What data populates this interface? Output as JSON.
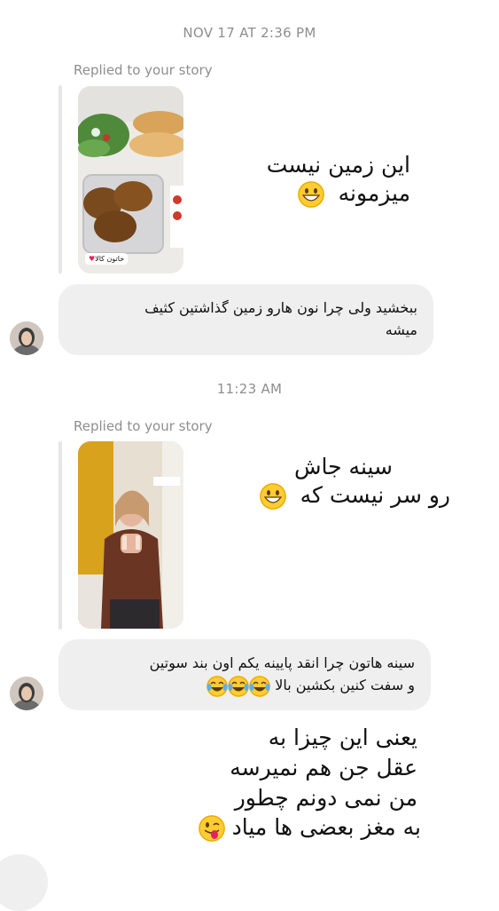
{
  "conversation": {
    "timestamp_1": "NOV 17 AT 2:36 PM",
    "timestamp_2": "11:23 AM",
    "reply_1": {
      "label": "Replied to your story",
      "story_tag": "خاتون کالا",
      "line1": "این زمین نیست",
      "line2": "میزمونه",
      "emoji": "grinning-face"
    },
    "incoming_1": {
      "line1": "ببخشید ولی چرا نون هارو زمین گذاشتین کثیف",
      "line2": "میشه"
    },
    "reply_2": {
      "label": "Replied to your story",
      "line1": "سینه جاش",
      "line2": "رو سر نیست که",
      "emoji": "grinning-face"
    },
    "incoming_2": {
      "line1": "سینه هاتون چرا انقد پایینه یکم اون بند سوتین",
      "line2": "و سفت کنین بکشین بالا",
      "emoji": "face-with-tears-of-joy"
    },
    "outgoing_3": {
      "line1": "یعنی این چیزا به",
      "line2": "عقل جن هم نمیرسه",
      "line3": "من نمی دونم چطور",
      "line4": "به مغز بعضی ها میاد",
      "emoji": "winking-face-with-tongue"
    }
  },
  "colors": {
    "incoming_bubble": "#efefef",
    "meta_text": "#8e8e8e",
    "emoji_yellow": "#ffcc33"
  }
}
